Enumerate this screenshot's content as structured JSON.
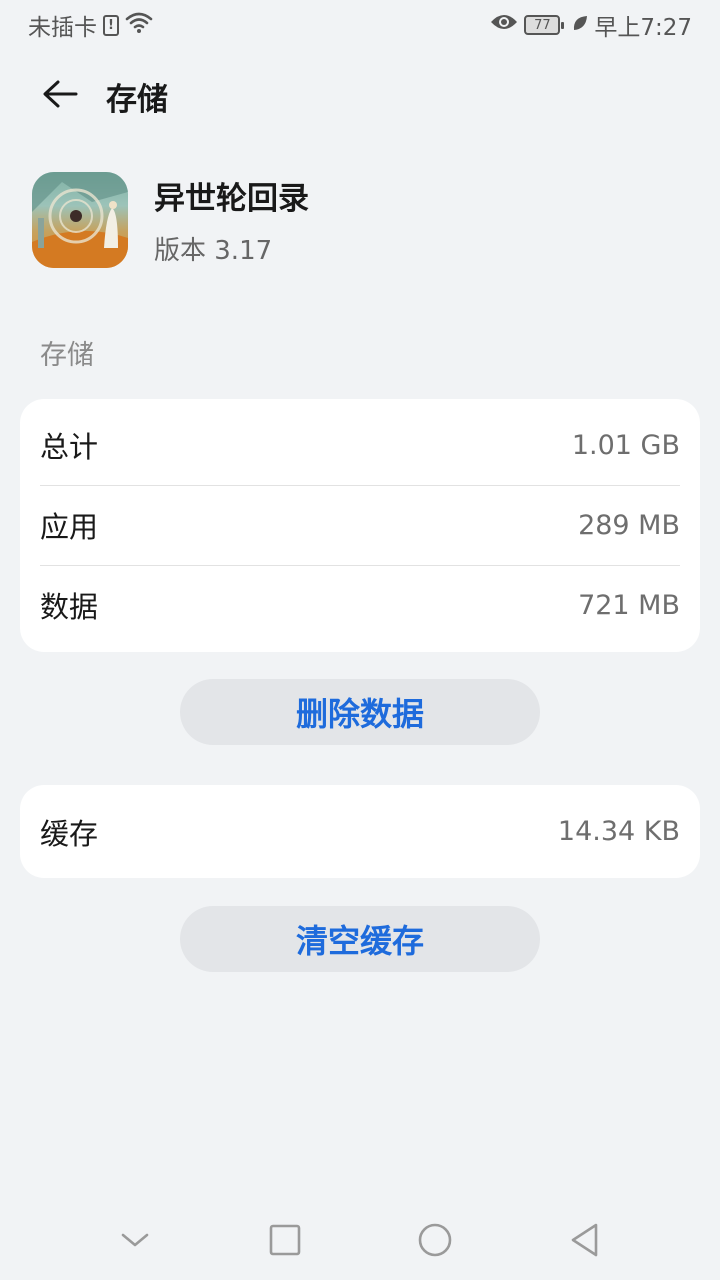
{
  "status_bar": {
    "carrier": "未插卡",
    "sim_alert": "!",
    "battery_level": "77",
    "time": "早上7:27",
    "icons": [
      "sim-alert-icon",
      "wifi-icon",
      "eye-comfort-icon",
      "battery-icon",
      "power-saving-leaf-icon"
    ]
  },
  "header": {
    "title": "存储",
    "back_icon": "back-arrow-icon"
  },
  "app": {
    "name": "异世轮回录",
    "version": "版本 3.17"
  },
  "storage_section": {
    "label": "存储",
    "rows": [
      {
        "label": "总计",
        "value": "1.01 GB"
      },
      {
        "label": "应用",
        "value": "289 MB"
      },
      {
        "label": "数据",
        "value": "721 MB"
      }
    ]
  },
  "actions": {
    "delete_data": "删除数据",
    "clear_cache": "清空缓存"
  },
  "cache_section": {
    "label": "缓存",
    "value": "14.34 KB"
  },
  "nav_bar": {
    "icons": [
      "collapse-chevron-icon",
      "recent-apps-icon",
      "home-icon",
      "back-triangle-icon"
    ]
  },
  "colors": {
    "background": "#f1f3f5",
    "card": "#ffffff",
    "accent": "#1e6bdc",
    "button_bg": "#e3e5e8"
  }
}
